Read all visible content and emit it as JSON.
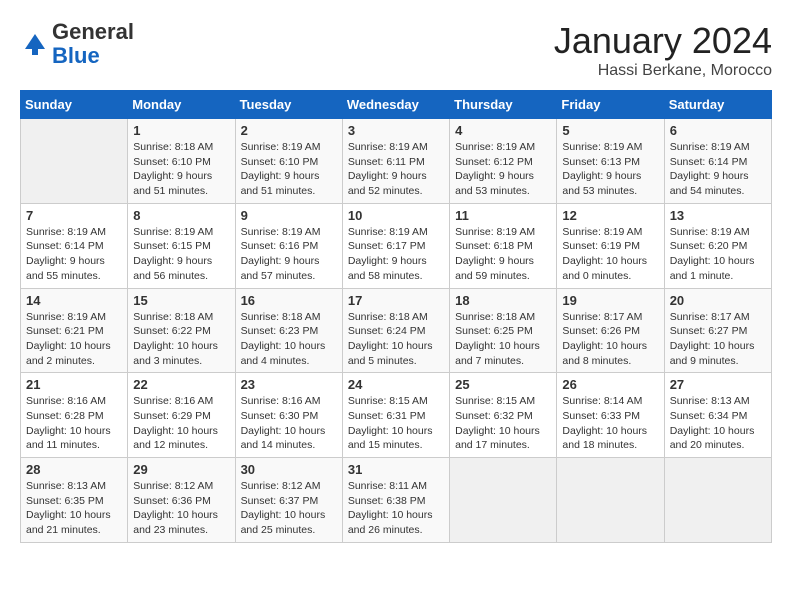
{
  "logo": {
    "general": "General",
    "blue": "Blue"
  },
  "header": {
    "month_title": "January 2024",
    "location": "Hassi Berkane, Morocco"
  },
  "weekdays": [
    "Sunday",
    "Monday",
    "Tuesday",
    "Wednesday",
    "Thursday",
    "Friday",
    "Saturday"
  ],
  "weeks": [
    [
      {
        "day": "",
        "sunrise": "",
        "sunset": "",
        "daylight": ""
      },
      {
        "day": "1",
        "sunrise": "Sunrise: 8:18 AM",
        "sunset": "Sunset: 6:10 PM",
        "daylight": "Daylight: 9 hours and 51 minutes."
      },
      {
        "day": "2",
        "sunrise": "Sunrise: 8:19 AM",
        "sunset": "Sunset: 6:10 PM",
        "daylight": "Daylight: 9 hours and 51 minutes."
      },
      {
        "day": "3",
        "sunrise": "Sunrise: 8:19 AM",
        "sunset": "Sunset: 6:11 PM",
        "daylight": "Daylight: 9 hours and 52 minutes."
      },
      {
        "day": "4",
        "sunrise": "Sunrise: 8:19 AM",
        "sunset": "Sunset: 6:12 PM",
        "daylight": "Daylight: 9 hours and 53 minutes."
      },
      {
        "day": "5",
        "sunrise": "Sunrise: 8:19 AM",
        "sunset": "Sunset: 6:13 PM",
        "daylight": "Daylight: 9 hours and 53 minutes."
      },
      {
        "day": "6",
        "sunrise": "Sunrise: 8:19 AM",
        "sunset": "Sunset: 6:14 PM",
        "daylight": "Daylight: 9 hours and 54 minutes."
      }
    ],
    [
      {
        "day": "7",
        "sunrise": "Sunrise: 8:19 AM",
        "sunset": "Sunset: 6:14 PM",
        "daylight": "Daylight: 9 hours and 55 minutes."
      },
      {
        "day": "8",
        "sunrise": "Sunrise: 8:19 AM",
        "sunset": "Sunset: 6:15 PM",
        "daylight": "Daylight: 9 hours and 56 minutes."
      },
      {
        "day": "9",
        "sunrise": "Sunrise: 8:19 AM",
        "sunset": "Sunset: 6:16 PM",
        "daylight": "Daylight: 9 hours and 57 minutes."
      },
      {
        "day": "10",
        "sunrise": "Sunrise: 8:19 AM",
        "sunset": "Sunset: 6:17 PM",
        "daylight": "Daylight: 9 hours and 58 minutes."
      },
      {
        "day": "11",
        "sunrise": "Sunrise: 8:19 AM",
        "sunset": "Sunset: 6:18 PM",
        "daylight": "Daylight: 9 hours and 59 minutes."
      },
      {
        "day": "12",
        "sunrise": "Sunrise: 8:19 AM",
        "sunset": "Sunset: 6:19 PM",
        "daylight": "Daylight: 10 hours and 0 minutes."
      },
      {
        "day": "13",
        "sunrise": "Sunrise: 8:19 AM",
        "sunset": "Sunset: 6:20 PM",
        "daylight": "Daylight: 10 hours and 1 minute."
      }
    ],
    [
      {
        "day": "14",
        "sunrise": "Sunrise: 8:19 AM",
        "sunset": "Sunset: 6:21 PM",
        "daylight": "Daylight: 10 hours and 2 minutes."
      },
      {
        "day": "15",
        "sunrise": "Sunrise: 8:18 AM",
        "sunset": "Sunset: 6:22 PM",
        "daylight": "Daylight: 10 hours and 3 minutes."
      },
      {
        "day": "16",
        "sunrise": "Sunrise: 8:18 AM",
        "sunset": "Sunset: 6:23 PM",
        "daylight": "Daylight: 10 hours and 4 minutes."
      },
      {
        "day": "17",
        "sunrise": "Sunrise: 8:18 AM",
        "sunset": "Sunset: 6:24 PM",
        "daylight": "Daylight: 10 hours and 5 minutes."
      },
      {
        "day": "18",
        "sunrise": "Sunrise: 8:18 AM",
        "sunset": "Sunset: 6:25 PM",
        "daylight": "Daylight: 10 hours and 7 minutes."
      },
      {
        "day": "19",
        "sunrise": "Sunrise: 8:17 AM",
        "sunset": "Sunset: 6:26 PM",
        "daylight": "Daylight: 10 hours and 8 minutes."
      },
      {
        "day": "20",
        "sunrise": "Sunrise: 8:17 AM",
        "sunset": "Sunset: 6:27 PM",
        "daylight": "Daylight: 10 hours and 9 minutes."
      }
    ],
    [
      {
        "day": "21",
        "sunrise": "Sunrise: 8:16 AM",
        "sunset": "Sunset: 6:28 PM",
        "daylight": "Daylight: 10 hours and 11 minutes."
      },
      {
        "day": "22",
        "sunrise": "Sunrise: 8:16 AM",
        "sunset": "Sunset: 6:29 PM",
        "daylight": "Daylight: 10 hours and 12 minutes."
      },
      {
        "day": "23",
        "sunrise": "Sunrise: 8:16 AM",
        "sunset": "Sunset: 6:30 PM",
        "daylight": "Daylight: 10 hours and 14 minutes."
      },
      {
        "day": "24",
        "sunrise": "Sunrise: 8:15 AM",
        "sunset": "Sunset: 6:31 PM",
        "daylight": "Daylight: 10 hours and 15 minutes."
      },
      {
        "day": "25",
        "sunrise": "Sunrise: 8:15 AM",
        "sunset": "Sunset: 6:32 PM",
        "daylight": "Daylight: 10 hours and 17 minutes."
      },
      {
        "day": "26",
        "sunrise": "Sunrise: 8:14 AM",
        "sunset": "Sunset: 6:33 PM",
        "daylight": "Daylight: 10 hours and 18 minutes."
      },
      {
        "day": "27",
        "sunrise": "Sunrise: 8:13 AM",
        "sunset": "Sunset: 6:34 PM",
        "daylight": "Daylight: 10 hours and 20 minutes."
      }
    ],
    [
      {
        "day": "28",
        "sunrise": "Sunrise: 8:13 AM",
        "sunset": "Sunset: 6:35 PM",
        "daylight": "Daylight: 10 hours and 21 minutes."
      },
      {
        "day": "29",
        "sunrise": "Sunrise: 8:12 AM",
        "sunset": "Sunset: 6:36 PM",
        "daylight": "Daylight: 10 hours and 23 minutes."
      },
      {
        "day": "30",
        "sunrise": "Sunrise: 8:12 AM",
        "sunset": "Sunset: 6:37 PM",
        "daylight": "Daylight: 10 hours and 25 minutes."
      },
      {
        "day": "31",
        "sunrise": "Sunrise: 8:11 AM",
        "sunset": "Sunset: 6:38 PM",
        "daylight": "Daylight: 10 hours and 26 minutes."
      },
      {
        "day": "",
        "sunrise": "",
        "sunset": "",
        "daylight": ""
      },
      {
        "day": "",
        "sunrise": "",
        "sunset": "",
        "daylight": ""
      },
      {
        "day": "",
        "sunrise": "",
        "sunset": "",
        "daylight": ""
      }
    ]
  ]
}
